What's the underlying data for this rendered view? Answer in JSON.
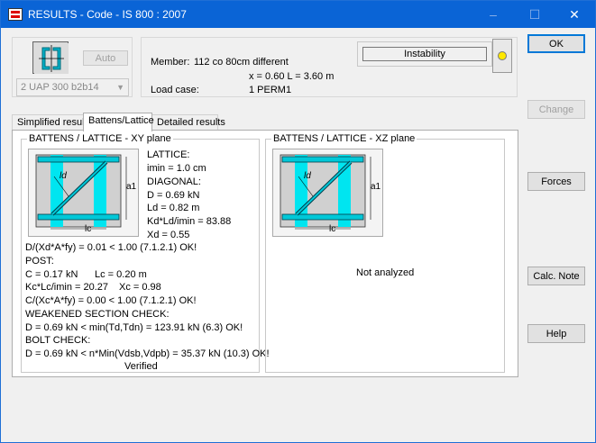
{
  "window": {
    "title": "RESULTS - Code - IS 800 : 2007",
    "controls": {
      "minimize": "–",
      "maximize": "☐",
      "close": "✕"
    }
  },
  "top_panel": {
    "auto_button": "Auto",
    "section_select": "2 UAP 300 b2b14",
    "member_label": "Member:",
    "member_value": "112  co 80cm different",
    "position_value": "x = 0.60 L = 3.60 m",
    "load_case_label": "Load case:",
    "load_case_value": "1 PERM1",
    "status_field": "Instability",
    "status_color": "#ffe800"
  },
  "tabs": [
    {
      "label": "Simplified results",
      "active": false
    },
    {
      "label": "Battens/Lattice",
      "active": true
    },
    {
      "label": "Detailed results",
      "active": false
    }
  ],
  "xy_plane": {
    "title": "BATTENS / LATTICE  - XY plane",
    "diagram_labels": {
      "length": "ld",
      "spacing": "lc",
      "height": "a1"
    },
    "side_lines": [
      "LATTICE:",
      "imin = 1.0 cm",
      "DIAGONAL:",
      "D = 0.69 kN",
      "Ld = 0.82 m",
      "Kd*Ld/imin = 83.88",
      "Xd = 0.55"
    ],
    "lines": [
      "D/(Xd*A*fy) = 0.01 < 1.00  (7.1.2.1)  OK!",
      "POST:",
      "C = 0.17 kN",
      "Lc = 0.20 m",
      "Kc*Lc/imin = 20.27",
      "Xc = 0.98",
      "C/(Xc*A*fy) = 0.00 < 1.00  (7.1.2.1)  OK!",
      "WEAKENED SECTION CHECK:",
      "D = 0.69 kN < min(Td,Tdn) = 123.91 kN (6.3)  OK!",
      "BOLT CHECK:",
      "D = 0.69 kN < n*Min(Vdsb,Vdpb) = 35.37 kN (10.3) OK!"
    ],
    "verdict": "Verified"
  },
  "xz_plane": {
    "title": "BATTENS / LATTICE  - XZ plane",
    "diagram_labels": {
      "length": "ld",
      "spacing": "lc",
      "height": "a1"
    },
    "message": "Not analyzed"
  },
  "buttons": {
    "ok": "OK",
    "change": "Change",
    "forces": "Forces",
    "calc_note": "Calc. Note",
    "help": "Help"
  }
}
